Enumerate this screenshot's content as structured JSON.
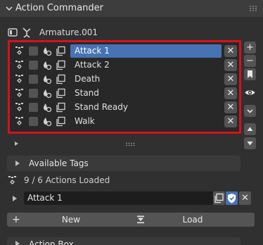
{
  "panel": {
    "title": "Action Commander"
  },
  "armature": {
    "name": "Armature.001"
  },
  "actions": [
    {
      "name": "Attack 1",
      "selected": true
    },
    {
      "name": "Attack 2",
      "selected": false
    },
    {
      "name": "Death",
      "selected": false
    },
    {
      "name": "Stand",
      "selected": false
    },
    {
      "name": "Stand Ready",
      "selected": false
    },
    {
      "name": "Walk",
      "selected": false
    }
  ],
  "remove_glyph": "✕",
  "side_buttons": {
    "add": "+",
    "remove": "−"
  },
  "available_tags": {
    "label": "Available Tags"
  },
  "status": {
    "loaded_text": "9 / 6 Actions Loaded"
  },
  "active_action": {
    "value": "Attack 1"
  },
  "buttons": {
    "new_label": "New",
    "load_label": "Load"
  },
  "action_box": {
    "label": "Action Box"
  },
  "colors": {
    "accent": "#4772b3",
    "highlight_border": "#d6121a",
    "panel": "#303030"
  }
}
